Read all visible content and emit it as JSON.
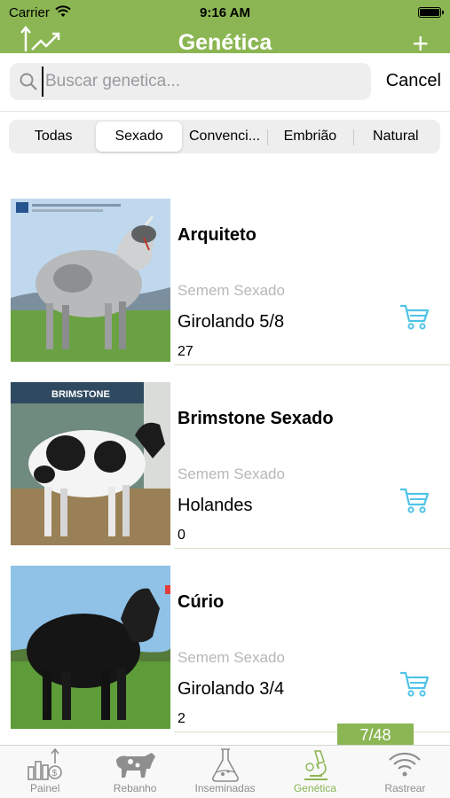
{
  "status": {
    "carrier": "Carrier",
    "time": "9:16 AM"
  },
  "nav": {
    "title": "Genética",
    "plus": "+"
  },
  "search": {
    "placeholder": "Buscar genetica...",
    "value": "",
    "cancel": "Cancel"
  },
  "segments": [
    "Todas",
    "Sexado",
    "Convenci...",
    "Embrião",
    "Natural"
  ],
  "active_segment": "Sexado",
  "items": [
    {
      "name": "Arquiteto",
      "type": "Semem Sexado",
      "breed": "Girolando 5/8",
      "count": "27"
    },
    {
      "name": "Brimstone Sexado",
      "type": "Semem Sexado",
      "breed": "Holandes",
      "count": "0"
    },
    {
      "name": "Cúrio",
      "type": "Semem Sexado",
      "breed": "Girolando 3/4",
      "count": "2"
    }
  ],
  "photo_texts": {
    "brimstone": "BRIMSTONE"
  },
  "page_indicator": "7/48",
  "tabs": [
    {
      "label": "Painel",
      "icon": "chart-dollar-icon"
    },
    {
      "label": "Rebanho",
      "icon": "cow-icon"
    },
    {
      "label": "Inseminadas",
      "icon": "flask-icon"
    },
    {
      "label": "Genética",
      "icon": "microscope-icon"
    },
    {
      "label": "Rastrear",
      "icon": "wifi-signal-icon"
    }
  ],
  "active_tab": "Genética",
  "colors": {
    "brand_green": "#8bb653",
    "cart_blue": "#4fc3e8",
    "muted_text": "#b7b7b7"
  }
}
